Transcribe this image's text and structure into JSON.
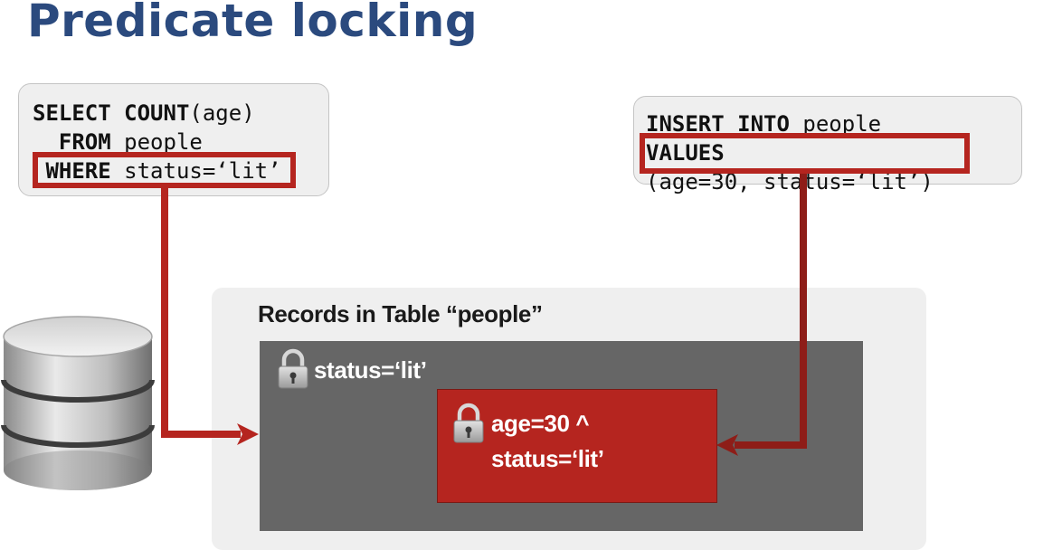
{
  "title": "Predicate locking",
  "select_query": {
    "line1_kw": "SELECT COUNT",
    "line1_rest": "(age)",
    "line2_kw": "FROM",
    "line2_rest": " people",
    "line3_kw": "WHERE",
    "line3_rest": " status=‘lit’"
  },
  "insert_query": {
    "line1_kw": "INSERT INTO",
    "line1_rest": " people",
    "line2_kw": "VALUES",
    "line3": "(age=30, status=‘lit’)"
  },
  "records": {
    "title": "Records in Table “people”",
    "predicate_lock_label": "status=‘lit’",
    "row_lock_line1": "age=30 ^",
    "row_lock_line2": "status=‘lit’"
  },
  "colors": {
    "title": "#2b4a7e",
    "highlight": "#b5251f",
    "arrow_dark": "#8e1d18",
    "predicate_area": "#666666",
    "row_area": "#b5251f"
  },
  "icons": [
    "database-icon",
    "lock-icon",
    "lock-icon",
    "arrow-right-icon",
    "arrow-left-icon"
  ]
}
